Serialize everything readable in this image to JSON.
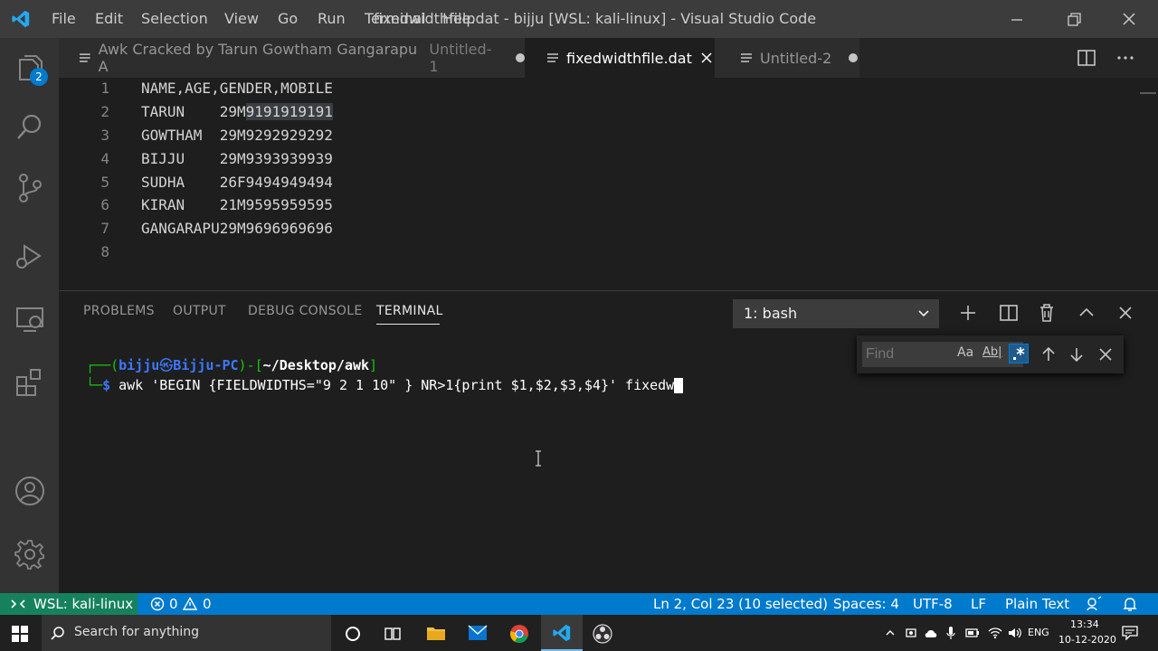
{
  "titlebar": {
    "menu": [
      "File",
      "Edit",
      "Selection",
      "View",
      "Go",
      "Run",
      "Terminal",
      "Help"
    ],
    "title": "fixedwidthfile.dat - bijju [WSL: kali-linux] - Visual Studio Code"
  },
  "activity": {
    "scm_badge": "2"
  },
  "tabs": [
    {
      "label": "Awk Cracked by Tarun Gowtham Gangarapu A",
      "sub": "Untitled-1",
      "state": "modified"
    },
    {
      "label": "fixedwidthfile.dat",
      "state": "active"
    },
    {
      "label": "Untitled-2",
      "state": "modified"
    }
  ],
  "editor": {
    "lines": [
      {
        "num": "1",
        "text": "NAME,AGE,GENDER,MOBILE"
      },
      {
        "num": "2",
        "text": "TARUN    29M",
        "selected": "9191919191"
      },
      {
        "num": "3",
        "text": "GOWTHAM  29M9292929292"
      },
      {
        "num": "4",
        "text": "BIJJU    29M9393939939"
      },
      {
        "num": "5",
        "text": "SUDHA    26F9494949494"
      },
      {
        "num": "6",
        "text": "KIRAN    21M9595959595"
      },
      {
        "num": "7",
        "text": "GANGARAPU29M9696969696"
      },
      {
        "num": "8",
        "text": ""
      }
    ]
  },
  "panel": {
    "tabs": [
      "PROBLEMS",
      "OUTPUT",
      "DEBUG CONSOLE",
      "TERMINAL"
    ],
    "terminal_select": "1: bash",
    "find_placeholder": "Find",
    "find_opts": {
      "case": "Aa",
      "word": "Ab|"
    },
    "prompt": {
      "box": "┌──(",
      "user": "bijju",
      "at": "㉿",
      "host": "Bijju-PC",
      "sep": ")-[",
      "path": "~/Desktop/awk",
      "close": "]",
      "arrow": "└─",
      "dollar": "$",
      "command": "awk 'BEGIN {FIELDWIDTHS=\"9 2 1 10\" } NR>1{print $1,$2,$3,$4}' fixedw"
    }
  },
  "status": {
    "remote": "WSL: kali-linux",
    "errors": "0",
    "warnings": "0",
    "position": "Ln 2, Col 23 (10 selected)",
    "spaces": "Spaces: 4",
    "encoding": "UTF-8",
    "eol": "LF",
    "language": "Plain Text"
  },
  "taskbar": {
    "search_placeholder": "Search for anything",
    "lang": "ENG",
    "time": "13:34",
    "date": "10-12-2020"
  },
  "colors": {
    "accent": "#007acc",
    "remote": "#16825d",
    "prompt_green": "#16c60c",
    "prompt_blue": "#3b78ff",
    "prompt_white": "#ffffff"
  }
}
